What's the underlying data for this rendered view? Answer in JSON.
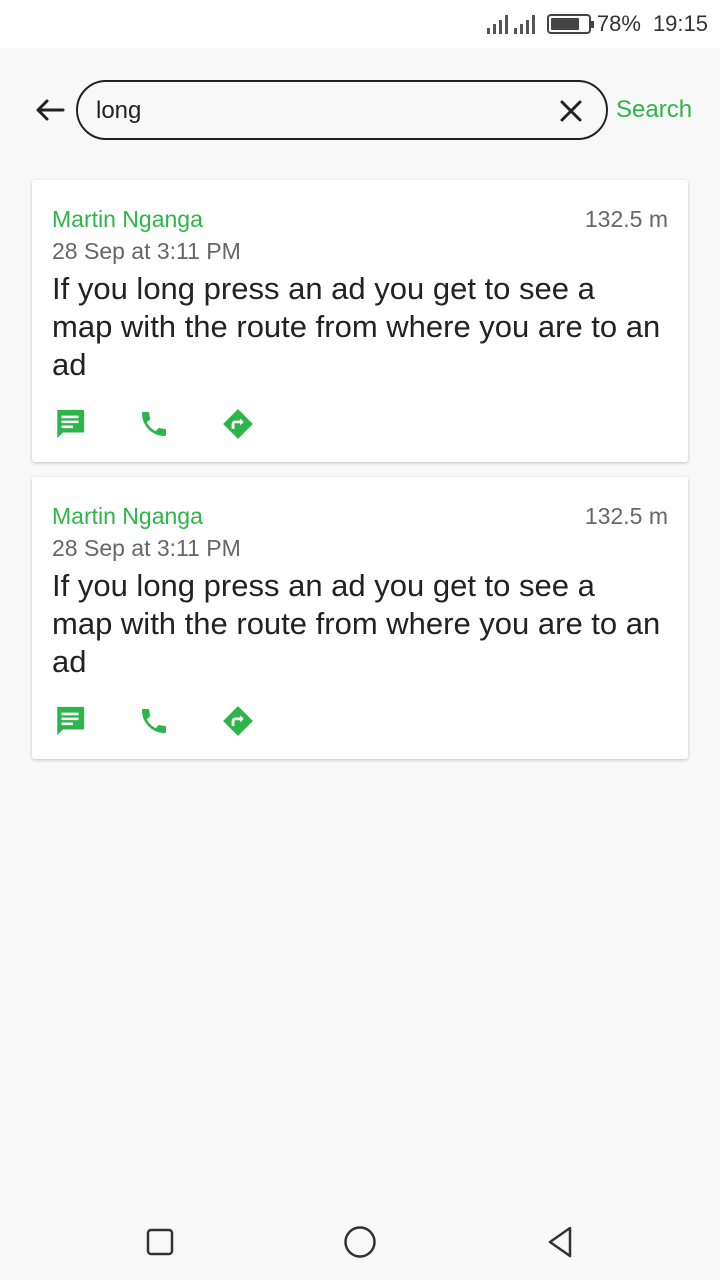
{
  "status": {
    "battery_percent": "78%",
    "battery_level": 0.78,
    "time": "19:15"
  },
  "header": {
    "back_icon": "arrow-left-icon",
    "search_value": "long",
    "clear_icon": "close-icon",
    "search_label": "Search"
  },
  "results": [
    {
      "author": "Martin Nganga",
      "distance": "132.5 m",
      "date": "28 Sep at 3:11 PM",
      "message": "If you long press an ad you get to see a map with the route from where you are to an ad",
      "actions": [
        "message-icon",
        "phone-icon",
        "directions-icon"
      ]
    },
    {
      "author": "Martin Nganga",
      "distance": "132.5 m",
      "date": "28 Sep at 3:11 PM",
      "message": "If you long press an ad you get to see a map with the route from where you are to an ad",
      "actions": [
        "message-icon",
        "phone-icon",
        "directions-icon"
      ]
    }
  ],
  "nav": [
    "recents-square-icon",
    "home-circle-icon",
    "back-triangle-icon"
  ],
  "colors": {
    "accent": "#2db54a",
    "background": "#f8f8f8",
    "card": "#ffffff",
    "text": "#222222",
    "muted": "#666666"
  }
}
